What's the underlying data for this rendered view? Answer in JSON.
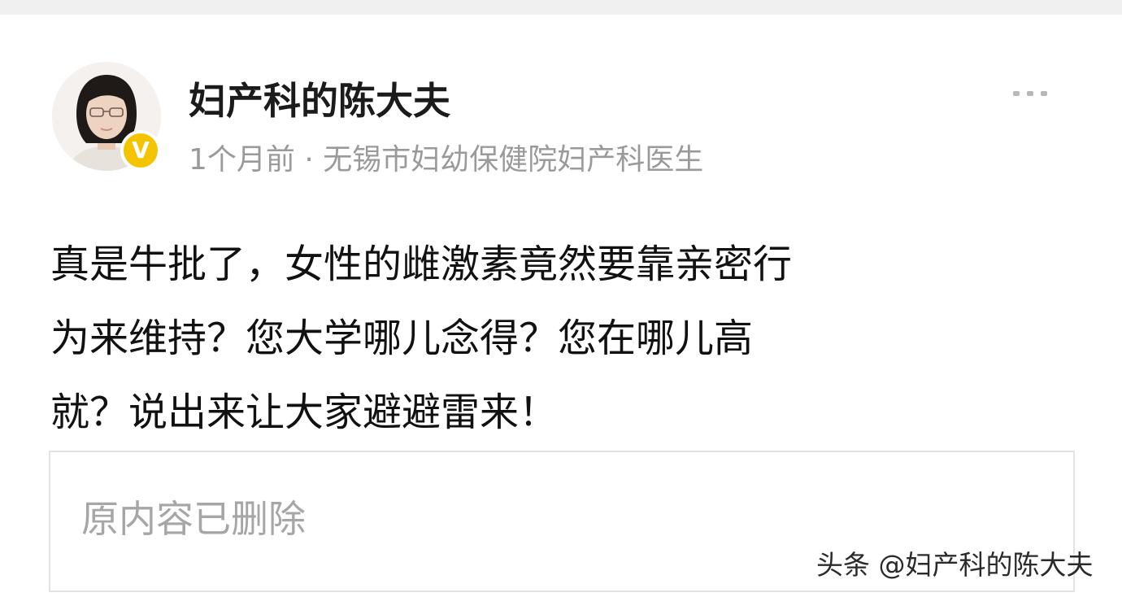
{
  "post": {
    "author": {
      "name": "妇产科的陈大夫",
      "verified_badge": "V",
      "verified_color": "#f5c400"
    },
    "meta": "1个月前 · 无锡市妇幼保健院妇产科医生",
    "content_lines": [
      "真是牛批了，女性的雌激素竟然要靠亲密行",
      "为来维持？您大学哪儿念得？您在哪儿高",
      "就？说出来让大家避避雷来！"
    ],
    "quoted": {
      "text": "原内容已删除"
    }
  },
  "watermark": "头条 @妇产科的陈大夫",
  "icons": {
    "avatar": "user-avatar-photo",
    "badge": "verified-v-icon",
    "menu": "more-dots-icon"
  }
}
